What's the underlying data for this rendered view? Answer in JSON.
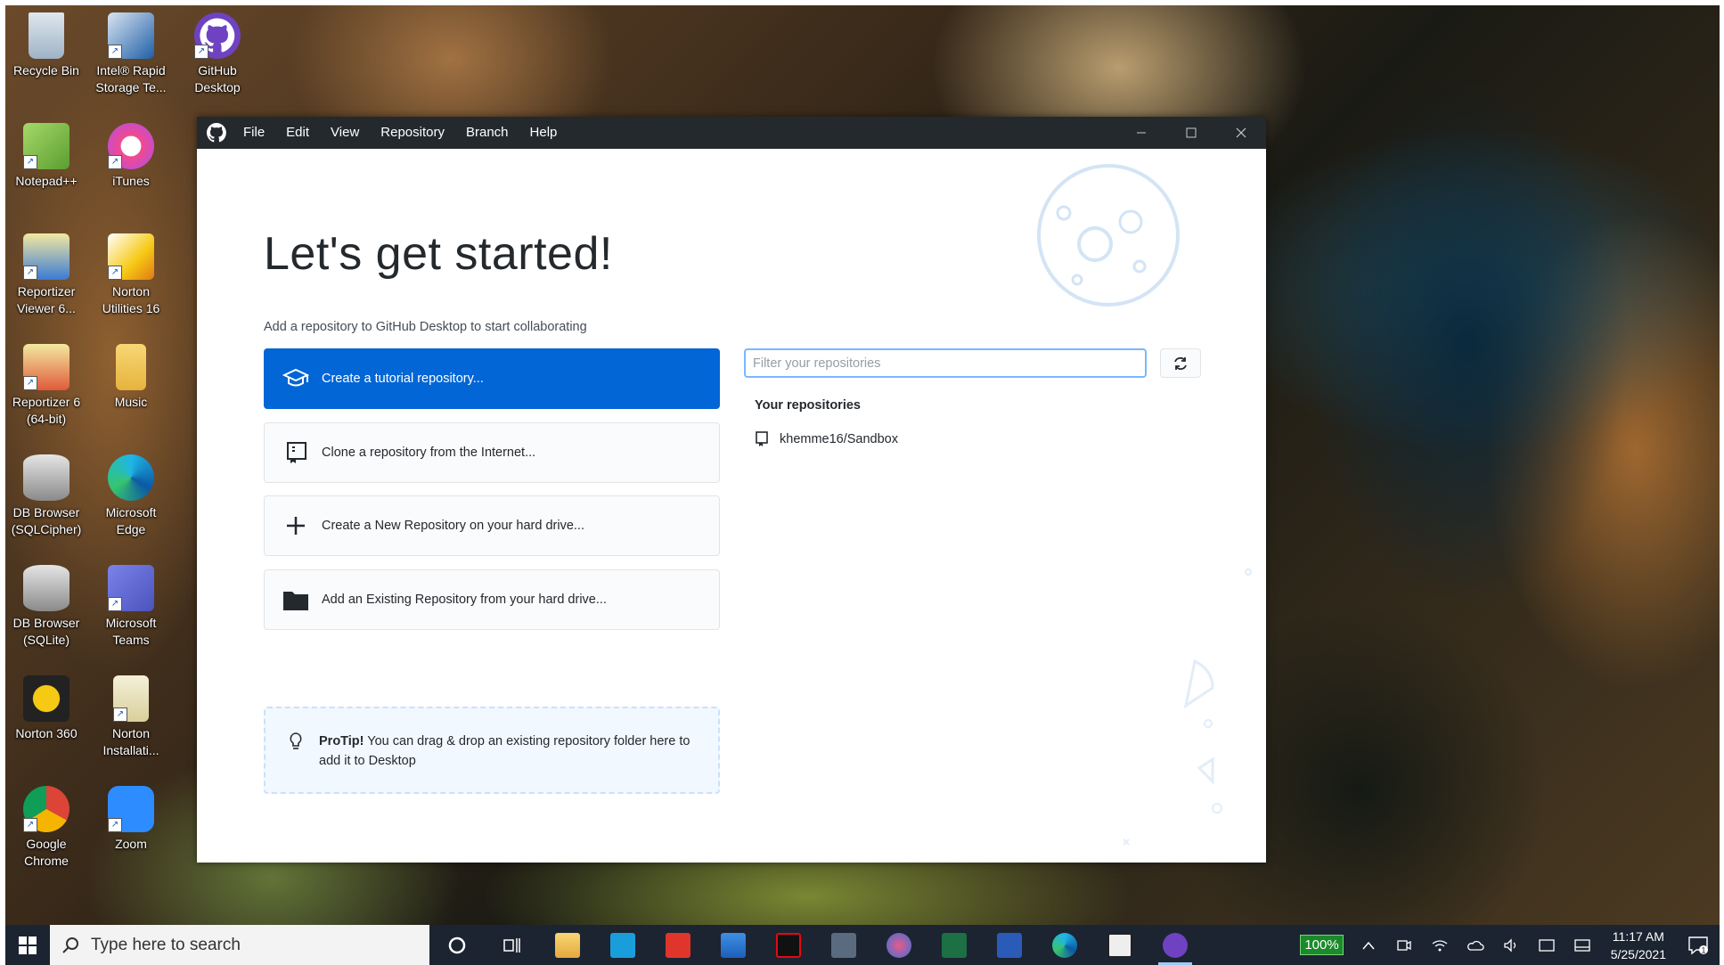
{
  "desktop": {
    "icons": [
      {
        "label": "Recycle Bin"
      },
      {
        "label": "Intel® Rapid Storage Te..."
      },
      {
        "label": "GitHub Desktop"
      },
      {
        "label": "Notepad++"
      },
      {
        "label": "iTunes"
      },
      {
        "label": "Reportizer Viewer 6..."
      },
      {
        "label": "Norton Utilities 16"
      },
      {
        "label": "Reportizer 6 (64-bit)"
      },
      {
        "label": "Music"
      },
      {
        "label": "DB Browser (SQLCipher)"
      },
      {
        "label": "Microsoft Edge"
      },
      {
        "label": "DB Browser (SQLite)"
      },
      {
        "label": "Microsoft Teams"
      },
      {
        "label": "Norton 360"
      },
      {
        "label": "Norton Installati..."
      },
      {
        "label": "Google Chrome"
      },
      {
        "label": "Zoom"
      }
    ]
  },
  "window": {
    "menu": [
      "File",
      "Edit",
      "View",
      "Repository",
      "Branch",
      "Help"
    ],
    "title": "Let's get started!",
    "subtitle": "Add a repository to GitHub Desktop to start collaborating",
    "actions": [
      {
        "label": "Create a tutorial repository..."
      },
      {
        "label": "Clone a repository from the Internet..."
      },
      {
        "label": "Create a New Repository on your hard drive..."
      },
      {
        "label": "Add an Existing Repository from your hard drive..."
      }
    ],
    "protip": {
      "bold": "ProTip!",
      "text": " You can drag & drop an existing repository folder here to add it to Desktop"
    },
    "filter": {
      "placeholder": "Filter your repositories",
      "value": ""
    },
    "repos_heading": "Your repositories",
    "repos": [
      {
        "name": "khemme16/Sandbox"
      }
    ]
  },
  "taskbar": {
    "search_placeholder": "Type here to search",
    "battery": "100%",
    "time": "11:17 AM",
    "date": "5/25/2021",
    "notification_count": "1"
  },
  "colors": {
    "primary_button": "#0366d6",
    "titlebar": "#24292e",
    "taskbar": "#1c2431"
  }
}
